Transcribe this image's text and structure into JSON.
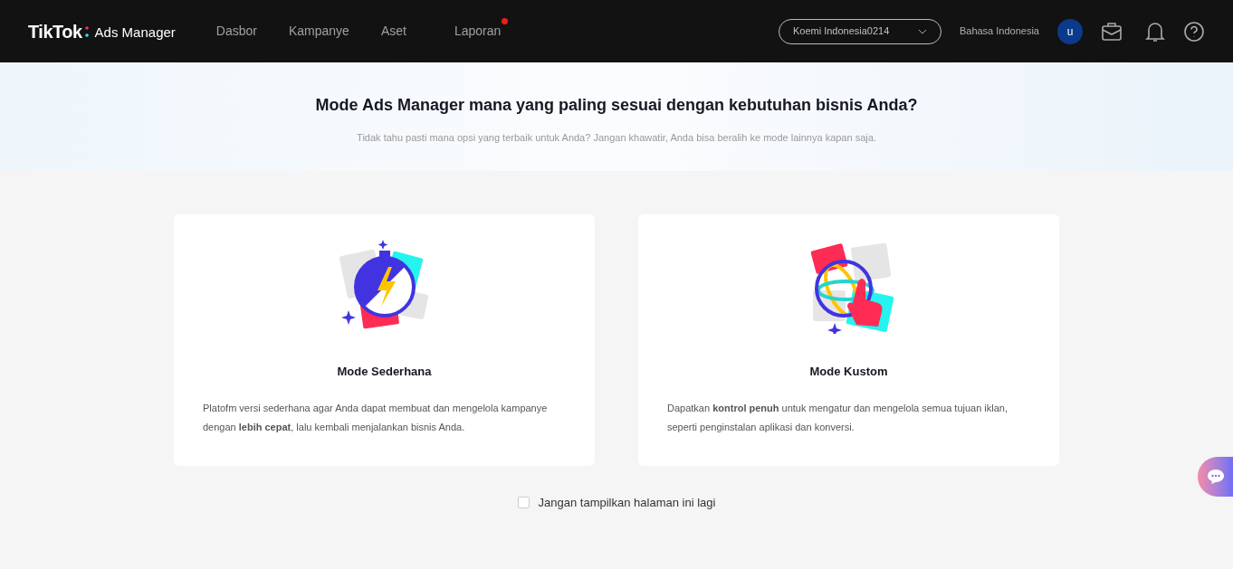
{
  "header": {
    "logo": "TikTok",
    "product": "Ads Manager",
    "nav": [
      {
        "label": "Dasbor",
        "dot": false
      },
      {
        "label": "Kampanye",
        "dot": false
      },
      {
        "label": "Aset",
        "dot": false
      },
      {
        "label": "Laporan",
        "dot": true
      }
    ],
    "account": "Koemi Indonesia0214",
    "language": "Bahasa Indonesia",
    "avatar": "u"
  },
  "hero": {
    "title": "Mode Ads Manager mana yang paling sesuai dengan kebutuhan bisnis Anda?",
    "subtitle": "Tidak tahu pasti mana opsi yang terbaik untuk Anda? Jangan khawatir, Anda bisa beralih ke mode lainnya kapan saja."
  },
  "modes": [
    {
      "kind": "simple",
      "title": "Mode Sederhana",
      "description": "Platofm versi sederhana agar Anda dapat membuat dan mengelola kampanye dengan **lebih cepat**, lalu kembali menjalankan bisnis Anda."
    },
    {
      "kind": "custom",
      "title": "Mode Kustom",
      "description": "Dapatkan **kontrol penuh** untuk mengatur dan mengelola semua tujuan iklan, seperti penginstalan aplikasi dan konversi."
    }
  ],
  "dont_show": {
    "label": "Jangan tampilkan halaman ini lagi",
    "checked": false
  }
}
